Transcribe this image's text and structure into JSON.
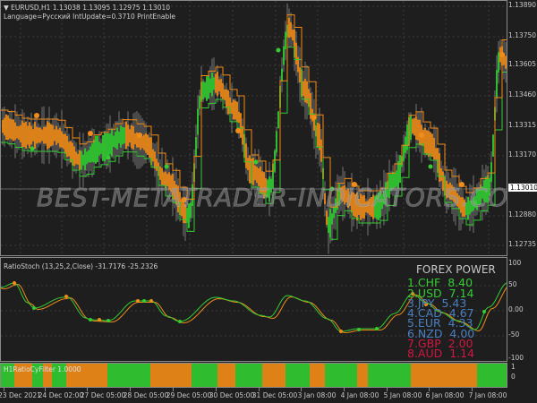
{
  "main_chart": {
    "symbol_info": "EURUSD,H1  1.13038 1.13095 1.12975 1.13010",
    "indicator_params": "Language=Русский  IntUpdate=0.3710  PrintEnable",
    "price_axis": [
      "1.13890",
      "1.13750",
      "1.13605",
      "1.13460",
      "1.13315",
      "1.13170",
      "1.12880",
      "1.12735"
    ],
    "current_price": "1.13010",
    "watermark": "BEST-METATRADER-INDICATORS.COM"
  },
  "oscillator": {
    "label": "RatioStoch (13,25,2,Close) -31.7176 -25.2326",
    "axis": [
      "100",
      "50",
      "0.00",
      "-50",
      "-100"
    ],
    "forex_power": {
      "title": "FOREX POWER",
      "rows": [
        {
          "text": "1.CHF  8.40",
          "color": "#33cc33"
        },
        {
          "text": "2.USD  7.14",
          "color": "#33cc33"
        },
        {
          "text": "3.JPY  5.43",
          "color": "#4a7fc0"
        },
        {
          "text": "4.CAD  4.67",
          "color": "#4a7fc0"
        },
        {
          "text": "5.EUR  4.33",
          "color": "#4a7fc0"
        },
        {
          "text": "6.NZD  4.00",
          "color": "#4a7fc0"
        },
        {
          "text": "7.GBP  2.00",
          "color": "#d01840"
        },
        {
          "text": "8.AUD  1.14",
          "color": "#d01840"
        }
      ]
    }
  },
  "filter": {
    "label": "H1RatioCyFilter 1.0000",
    "axis": [
      "1",
      "0"
    ]
  },
  "time_axis": [
    "23 Dec 2021",
    "24 Dec 02:00",
    "27 Dec 05:00",
    "28 Dec 05:00",
    "29 Dec 05:00",
    "30 Dec 05:00",
    "31 Dec 05:00",
    "3 Jan 08:00",
    "4 Jan 08:00",
    "5 Jan 08:00",
    "6 Jan 08:00",
    "7 Jan 08:00"
  ],
  "colors": {
    "bull": "#33cc33",
    "bear": "#f08c1a",
    "background": "#1e1e1e",
    "grid": "#3a3a3a"
  }
}
